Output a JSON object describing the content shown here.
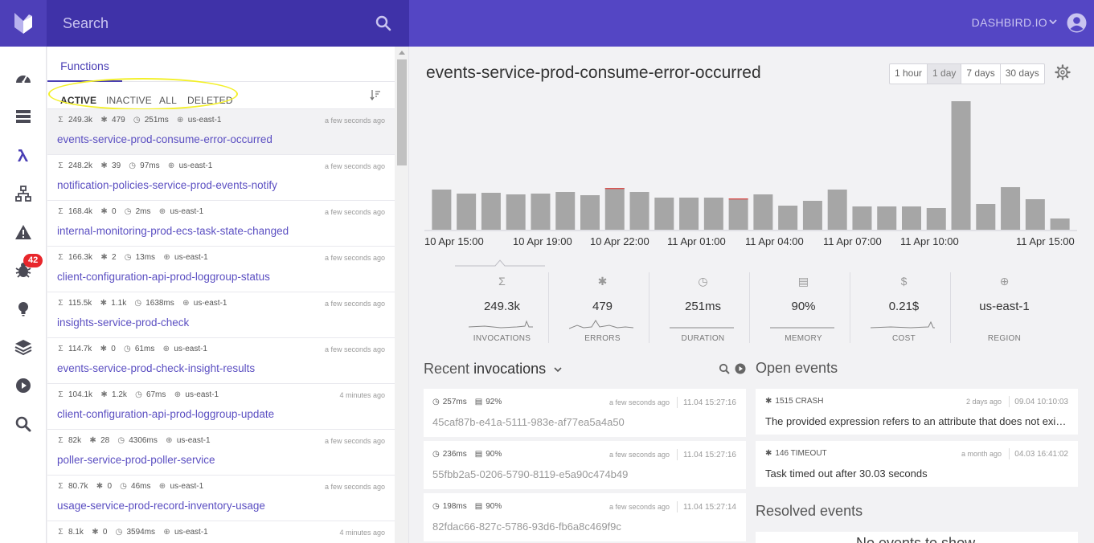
{
  "topbar": {
    "search_placeholder": "Search",
    "brand": "DASHBIRD.IO"
  },
  "nav": {
    "badge": "42",
    "icons": [
      "dashboard-icon",
      "database-icon",
      "lambda-icon",
      "network-icon",
      "alert-icon",
      "bug-icon",
      "lightbulb-icon",
      "layers-icon",
      "play-icon",
      "search-icon"
    ]
  },
  "functions_panel": {
    "tab": "Functions",
    "filters": [
      "ACTIVE",
      "INACTIVE",
      "ALL",
      "DELETED"
    ],
    "active_filter": "ACTIVE",
    "items": [
      {
        "invocations": "249.3k",
        "errors": "479",
        "duration": "251ms",
        "region": "us-east-1",
        "time": "a few seconds ago",
        "name": "events-service-prod-consume-error-occurred"
      },
      {
        "invocations": "248.2k",
        "errors": "39",
        "duration": "97ms",
        "region": "us-east-1",
        "time": "a few seconds ago",
        "name": "notification-policies-service-prod-events-notify"
      },
      {
        "invocations": "168.4k",
        "errors": "0",
        "duration": "2ms",
        "region": "us-east-1",
        "time": "a few seconds ago",
        "name": "internal-monitoring-prod-ecs-task-state-changed"
      },
      {
        "invocations": "166.3k",
        "errors": "2",
        "duration": "13ms",
        "region": "us-east-1",
        "time": "a few seconds ago",
        "name": "client-configuration-api-prod-loggroup-status"
      },
      {
        "invocations": "115.5k",
        "errors": "1.1k",
        "duration": "1638ms",
        "region": "us-east-1",
        "time": "a few seconds ago",
        "name": "insights-service-prod-check"
      },
      {
        "invocations": "114.7k",
        "errors": "0",
        "duration": "61ms",
        "region": "us-east-1",
        "time": "a few seconds ago",
        "name": "events-service-prod-check-insight-results"
      },
      {
        "invocations": "104.1k",
        "errors": "1.2k",
        "duration": "67ms",
        "region": "us-east-1",
        "time": "4 minutes ago",
        "name": "client-configuration-api-prod-loggroup-update"
      },
      {
        "invocations": "82k",
        "errors": "28",
        "duration": "4306ms",
        "region": "us-east-1",
        "time": "a few seconds ago",
        "name": "poller-service-prod-poller-service"
      },
      {
        "invocations": "80.7k",
        "errors": "0",
        "duration": "46ms",
        "region": "us-east-1",
        "time": "a few seconds ago",
        "name": "usage-service-prod-record-inventory-usage"
      },
      {
        "invocations": "8.1k",
        "errors": "0",
        "duration": "3594ms",
        "region": "us-east-1",
        "time": "4 minutes ago",
        "name": ""
      }
    ]
  },
  "main": {
    "title": "events-service-prod-consume-error-occurred",
    "ranges": [
      "1 hour",
      "1 day",
      "7 days",
      "30 days"
    ],
    "selected_range": "1 day",
    "stats": [
      {
        "icon": "sigma-icon",
        "value": "249.3k",
        "label": "INVOCATIONS"
      },
      {
        "icon": "bug-icon",
        "value": "479",
        "label": "ERRORS"
      },
      {
        "icon": "clock-icon",
        "value": "251ms",
        "label": "DURATION"
      },
      {
        "icon": "memory-icon",
        "value": "90%",
        "label": "MEMORY"
      },
      {
        "icon": "dollar-icon",
        "value": "0.21$",
        "label": "COST"
      },
      {
        "icon": "globe-icon",
        "value": "us-east-1",
        "label": "REGION"
      }
    ],
    "recent": {
      "heading_prefix": "Recent",
      "heading_bold": "invocations",
      "items": [
        {
          "duration": "257ms",
          "memory": "92%",
          "time": "a few seconds ago",
          "date": "11.04 15:27:16",
          "id": "45caf87b-e41a-5111-983e-af77ea5a4a50"
        },
        {
          "duration": "236ms",
          "memory": "90%",
          "time": "a few seconds ago",
          "date": "11.04 15:27:16",
          "id": "55fbb2a5-0206-5790-8119-e5a90c474b49"
        },
        {
          "duration": "198ms",
          "memory": "90%",
          "time": "a few seconds ago",
          "date": "11.04 15:27:14",
          "id": "82fdac66-827c-5786-93d6-fb6a8c469f9c"
        }
      ]
    },
    "open_events": {
      "heading": "Open events",
      "items": [
        {
          "meta": "1515 CRASH",
          "time": "2 days ago",
          "date": "09.04 10:10:03",
          "message": "The provided expression refers to an attribute that does not exist in the item"
        },
        {
          "meta": "146 TIMEOUT",
          "time": "a month ago",
          "date": "04.03 16:41:02",
          "message": "Task timed out after 30.03 seconds"
        }
      ]
    },
    "resolved_events": {
      "heading": "Resolved events",
      "empty_text": "No events to show"
    }
  },
  "chart_data": {
    "type": "bar",
    "categories": [
      "b1",
      "b2",
      "b3",
      "b4",
      "b5",
      "b6",
      "b7",
      "b8",
      "b9",
      "b10",
      "b11",
      "b12",
      "b13",
      "b14",
      "b15",
      "b16",
      "b17",
      "b18",
      "b19",
      "b20",
      "b21",
      "b22",
      "b23",
      "b24",
      "b25",
      "b26",
      "b27",
      "b28",
      "b29",
      "b30",
      "b31",
      "b32",
      "b33",
      "b34",
      "b35",
      "b36",
      "b37",
      "b38",
      "b39",
      "b40",
      "b41",
      "b42",
      "b43",
      "b44",
      "b45",
      "b46",
      "b47",
      "b48",
      "b49",
      "b50",
      "b51",
      "b52",
      "b53",
      "b54",
      "b55",
      "b56",
      "b57",
      "b58",
      "b59",
      "b60"
    ],
    "xtick_labels": [
      "10 Apr 15:00",
      "10 Apr 19:00",
      "10 Apr 22:00",
      "11 Apr 01:00",
      "11 Apr 04:00",
      "11 Apr 07:00",
      "11 Apr 10:00",
      "11 Apr 15:00"
    ],
    "values": [
      50,
      45,
      46,
      44,
      45,
      47,
      43,
      52,
      47,
      40,
      40,
      40,
      39,
      44,
      30,
      36,
      50,
      29,
      29,
      29,
      27,
      32,
      53,
      38,
      14
    ],
    "errors": [
      0,
      0,
      0,
      0,
      0,
      0,
      0,
      1,
      0,
      0,
      0,
      0,
      1,
      0,
      0,
      0,
      0,
      0,
      0,
      0,
      0,
      0,
      0,
      0,
      0
    ],
    "ylim": [
      0,
      160
    ],
    "colors": {
      "bar": "#a6a6a6",
      "error": "#d9534f"
    },
    "tall_bar": {
      "index": 21,
      "value": 160
    },
    "grid": false
  }
}
